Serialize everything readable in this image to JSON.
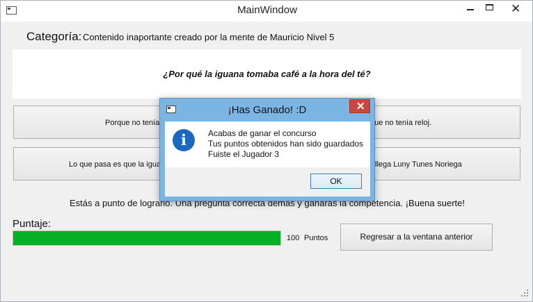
{
  "window": {
    "title": "MainWindow"
  },
  "category": {
    "label": "Categoría:",
    "value": "Contenido inaportante creado por la mente de Mauricio Nivel 5"
  },
  "question": "¿Por qué la iguana tomaba café a la hora del té?",
  "answers": [
    "Porque no tenía",
    "que no tenía reloj.",
    "Lo que pasa es que la iguan",
    "llega Luny Tunes  Noriega"
  ],
  "status_text": "Estás a punto de lograrlo. Una pregunta correcta demás y ganarás la competencia. ¡Buena suerte!",
  "score": {
    "label": "Puntaje:",
    "value": "100",
    "unit": "Puntos",
    "progress_percent": 100
  },
  "back_button": "Regresar a la ventana anterior",
  "dialog": {
    "title": "¡Has Ganado! :D",
    "lines": [
      "Acabas de ganar el concurso",
      "Tus puntos obtenidos han sido guardados",
      "Fuiste el Jugador 3"
    ],
    "ok_label": "OK",
    "icon": "information-icon"
  },
  "colors": {
    "progress": "#06b025",
    "dialog_frame": "#7ab5e4",
    "close_red": "#c7483c",
    "info_blue": "#1a68c0"
  }
}
